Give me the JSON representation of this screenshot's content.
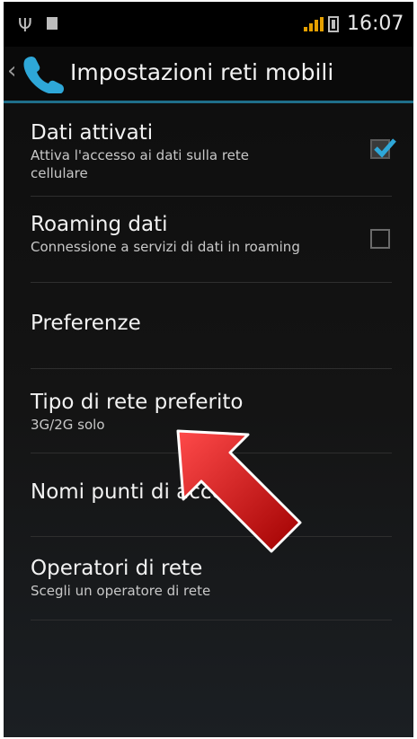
{
  "status_bar": {
    "time": "16:07",
    "usb_icon": "usb-icon",
    "notification_icon": "notification-icon",
    "signal_icon": "signal-icon",
    "battery_icon": "battery-icon"
  },
  "action_bar": {
    "title": "Impostazioni reti mobili",
    "back_icon": "chevron-left-icon",
    "app_icon": "phone-icon"
  },
  "settings": {
    "data_enabled": {
      "title": "Dati attivati",
      "summary": "Attiva l'accesso ai dati sulla rete cellulare",
      "checked": true
    },
    "data_roaming": {
      "title": "Roaming dati",
      "summary": "Connessione a servizi di dati in roaming",
      "checked": false
    },
    "preferences": {
      "title": "Preferenze"
    },
    "preferred_network": {
      "title": "Tipo di rete preferito",
      "summary": "3G/2G solo"
    },
    "access_point_names": {
      "title": "Nomi punti di accesso"
    },
    "network_operators": {
      "title": "Operatori di rete",
      "summary": "Scegli un operatore di rete"
    }
  },
  "overlay": {
    "arrow_icon": "red-arrow-icon",
    "arrow_color": "#d01010"
  },
  "colors": {
    "accent": "#1f6e8a",
    "check": "#2ea7d8"
  }
}
